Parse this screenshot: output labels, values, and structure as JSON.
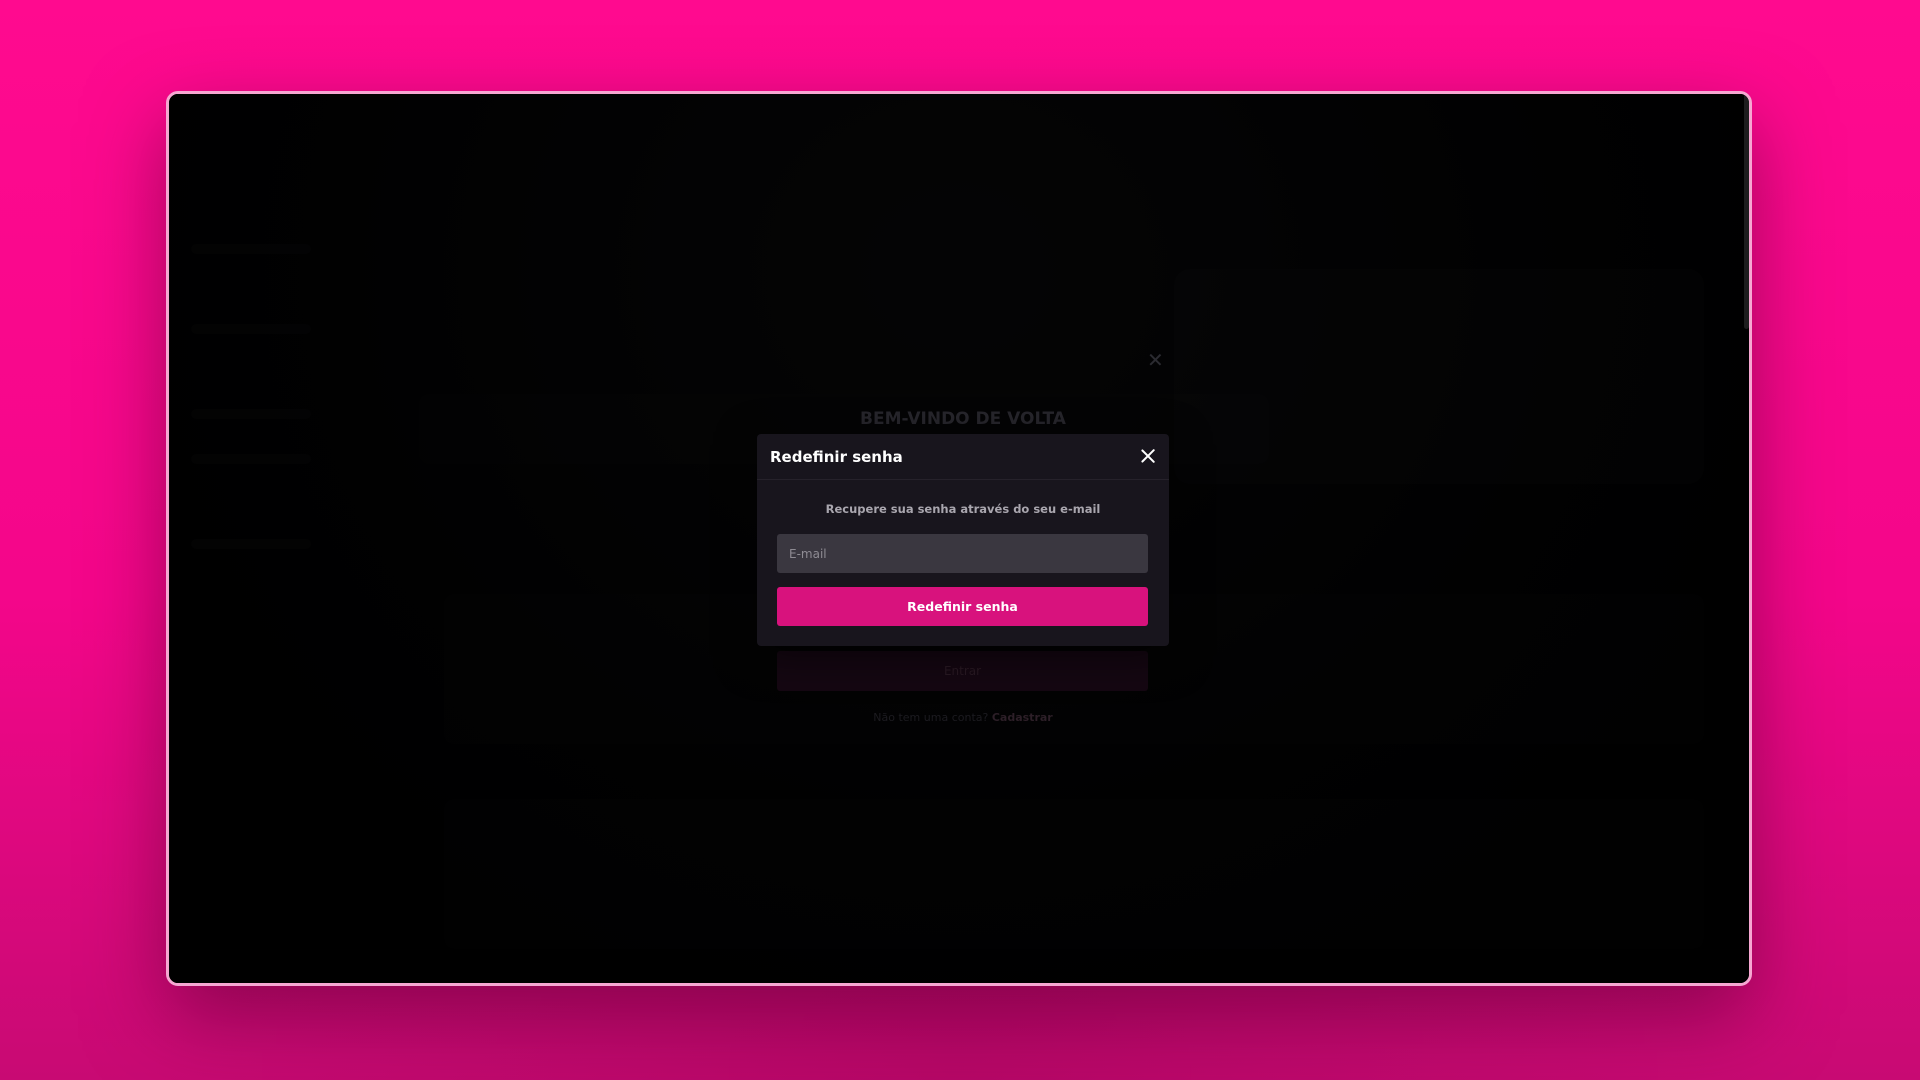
{
  "theme": {
    "accent": "#d8127d",
    "page_background": "#ff0a8f",
    "window_border": "#f6a7d2",
    "modal_background": "#18151d",
    "input_background": "#3a3740"
  },
  "login_modal": {
    "title": "BEM-VINDO DE VOLTA",
    "submit_label": "Entrar",
    "signup_prompt": "Não tem uma conta?",
    "signup_link": "Cadastrar",
    "close_icon": "close-icon"
  },
  "reset_modal": {
    "title": "Redefinir senha",
    "subtitle": "Recupere sua senha através do seu e-mail",
    "email": {
      "value": "",
      "placeholder": "E-mail"
    },
    "submit_label": "Redefinir senha",
    "close_icon": "close-icon"
  }
}
